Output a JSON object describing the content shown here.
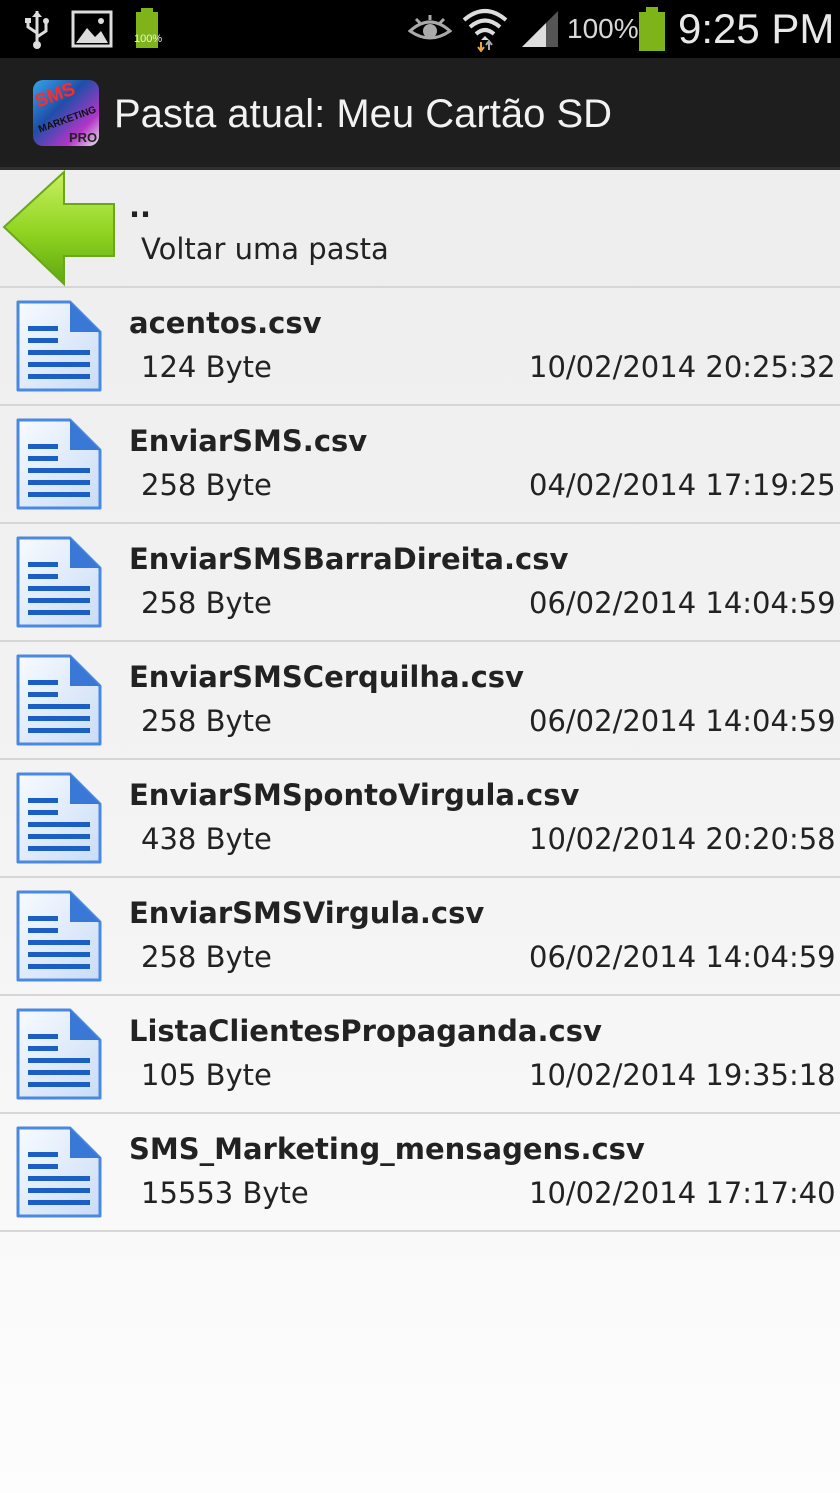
{
  "status_bar": {
    "battery_small_label": "100%",
    "battery_percent": "100%",
    "time": "9:25 PM"
  },
  "action_bar": {
    "title": "Pasta atual: Meu Cartão SD",
    "icon_text": [
      "SMS",
      "MARKETING",
      "PRO"
    ]
  },
  "up_row": {
    "name": "..",
    "label": "Voltar uma pasta"
  },
  "files": [
    {
      "name": "acentos.csv",
      "size": "124 Byte",
      "date": "10/02/2014 20:25:32"
    },
    {
      "name": "EnviarSMS.csv",
      "size": "258 Byte",
      "date": "04/02/2014 17:19:25"
    },
    {
      "name": "EnviarSMSBarraDireita.csv",
      "size": "258 Byte",
      "date": "06/02/2014 14:04:59"
    },
    {
      "name": "EnviarSMSCerquilha.csv",
      "size": "258 Byte",
      "date": "06/02/2014 14:04:59"
    },
    {
      "name": "EnviarSMSpontoVirgula.csv",
      "size": "438 Byte",
      "date": "10/02/2014 20:20:58"
    },
    {
      "name": "EnviarSMSVirgula.csv",
      "size": "258 Byte",
      "date": "06/02/2014 14:04:59"
    },
    {
      "name": "ListaClientesPropaganda.csv",
      "size": "105 Byte",
      "date": "10/02/2014 19:35:18"
    },
    {
      "name": "SMS_Marketing_mensagens.csv",
      "size": "15553 Byte",
      "date": "10/02/2014 17:17:40"
    }
  ],
  "colors": {
    "status_bar_bg": "#000000",
    "action_bar_bg": "#1e1e1e",
    "up_arrow_green": "#8fd320",
    "doc_icon_blue": "#1c5fc4"
  }
}
